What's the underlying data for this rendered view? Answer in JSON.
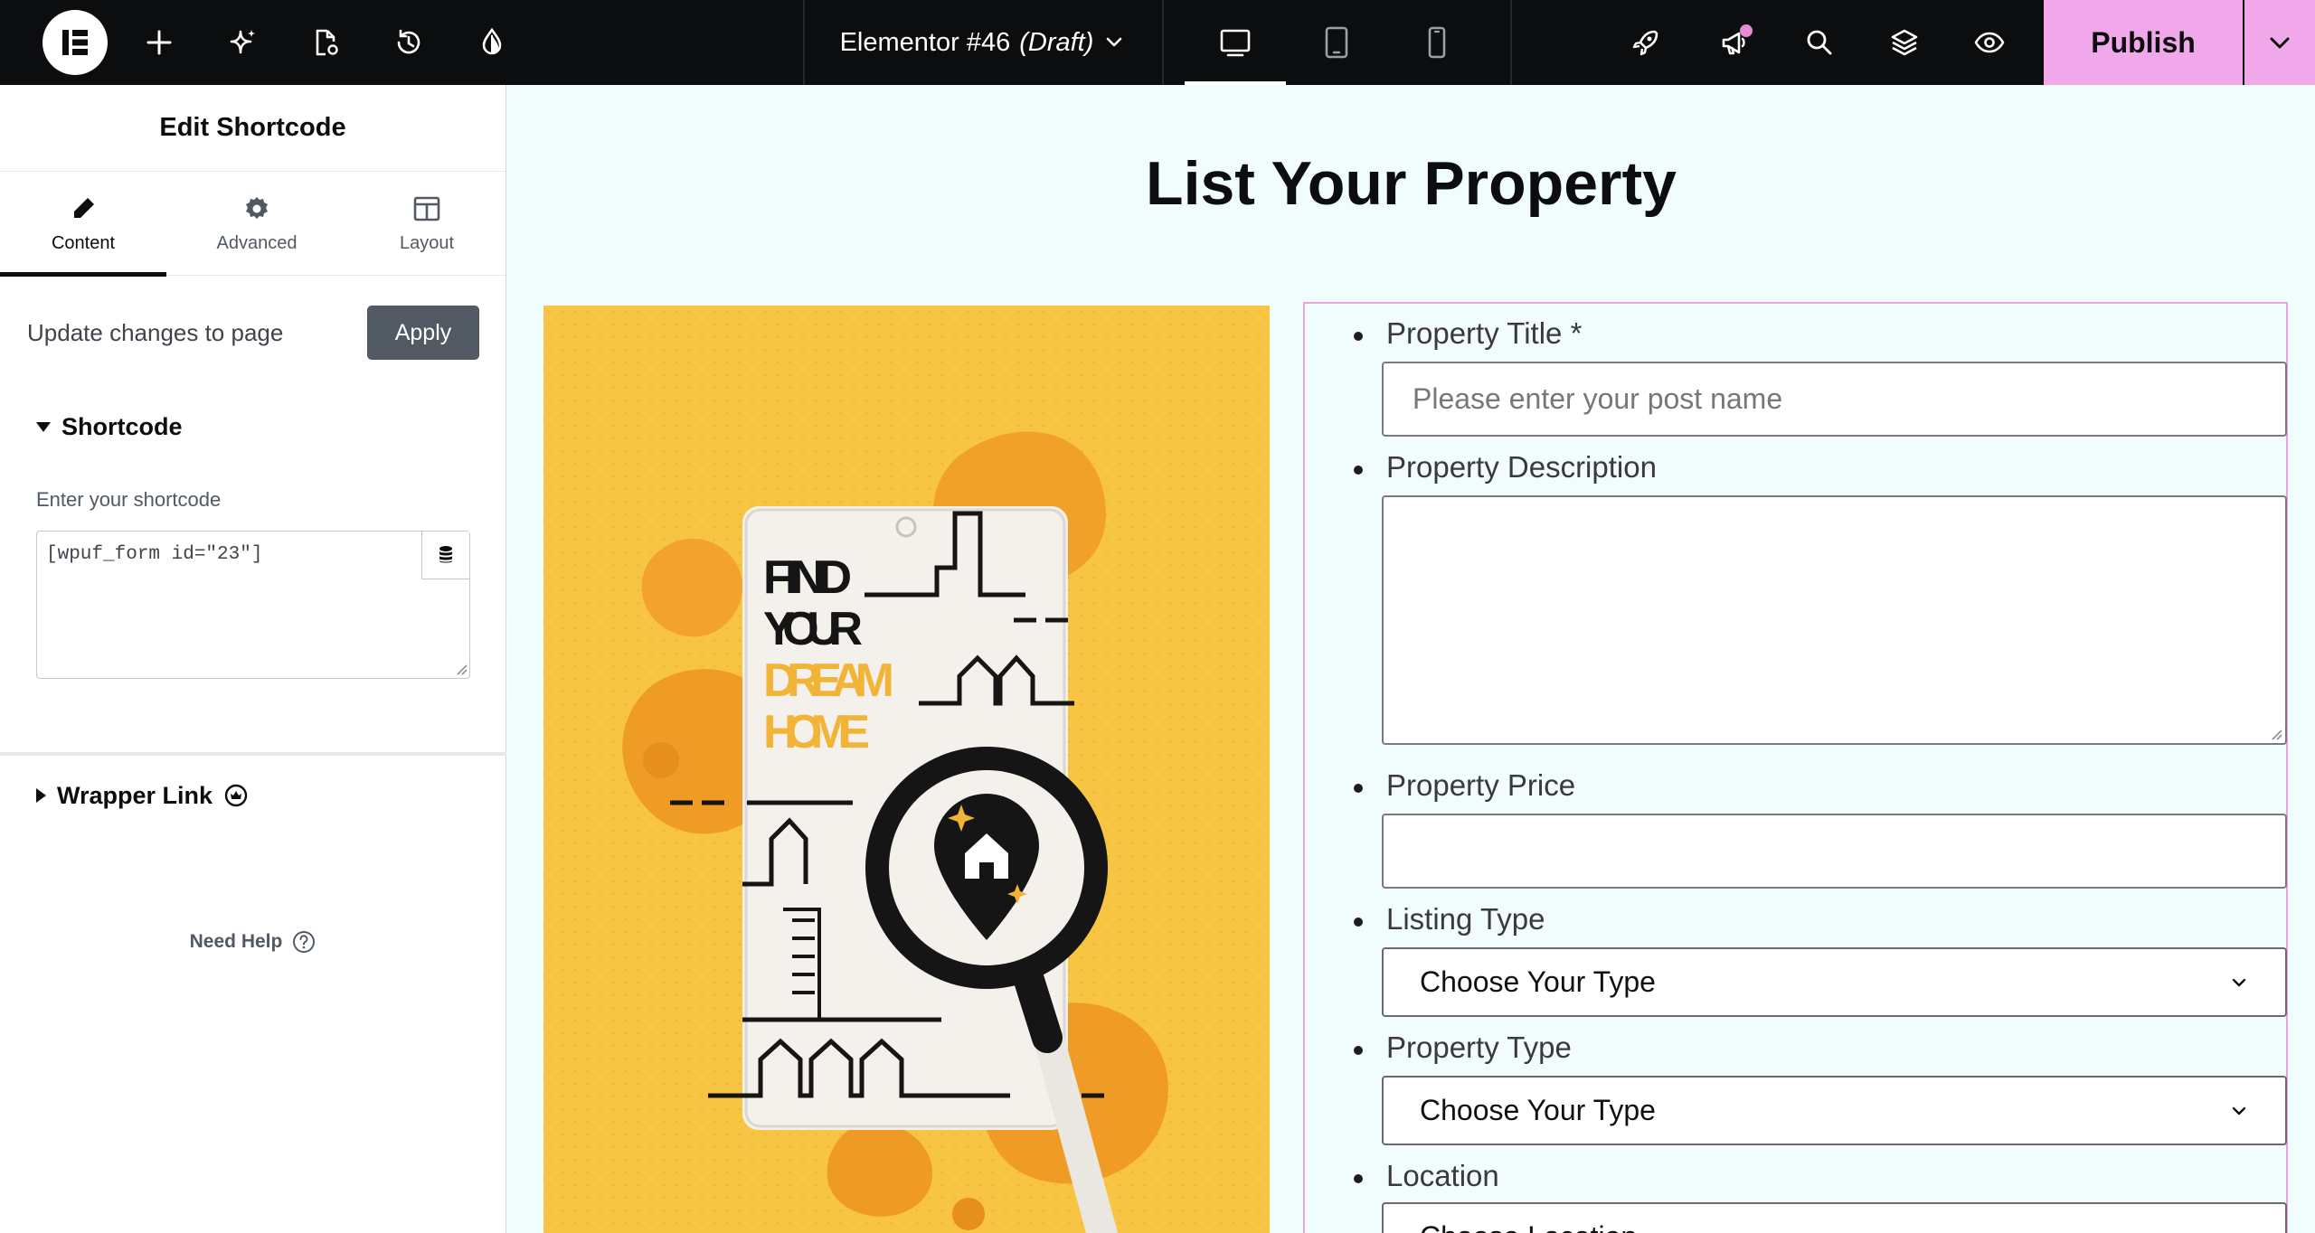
{
  "topbar": {
    "document_name": "Elementor #46",
    "document_status": "(Draft)",
    "publish_label": "Publish",
    "accent_color": "#f0a8ea",
    "icons": [
      "elementor-logo-icon",
      "add-element-icon",
      "ai-sparkle-icon",
      "page-settings-icon",
      "history-icon",
      "site-settings-icon",
      "chevron-down-icon",
      "desktop-icon",
      "tablet-icon",
      "mobile-icon",
      "rocket-icon",
      "megaphone-icon",
      "search-icon",
      "layers-icon",
      "preview-eye-icon"
    ]
  },
  "panel": {
    "title": "Edit Shortcode",
    "tabs": [
      {
        "label": "Content",
        "icon": "pencil-icon"
      },
      {
        "label": "Advanced",
        "icon": "gear-icon"
      },
      {
        "label": "Layout",
        "icon": "layout-columns-icon"
      }
    ],
    "update_label": "Update changes to page",
    "apply_label": "Apply",
    "shortcode_section": "Shortcode",
    "shortcode_field_label": "Enter your shortcode",
    "shortcode_value": "[wpuf_form id=\"23\"]",
    "wrapper_link_section": "Wrapper Link",
    "need_help": "Need Help"
  },
  "canvas": {
    "page_title": "List Your Property",
    "hero": {
      "line1": "FIND",
      "line2": "YOUR",
      "line3": "DREAM",
      "line4": "HOME"
    },
    "form": {
      "property_title_label": "Property Title *",
      "property_title_placeholder": "Please enter your post name",
      "description_label": "Property Description",
      "price_label": "Property Price",
      "listing_type_label": "Listing Type",
      "listing_type_value": "Choose Your Type",
      "property_type_label": "Property Type",
      "property_type_value": "Choose Your Type",
      "location_label": "Location",
      "location_value": "Choose Location"
    }
  }
}
